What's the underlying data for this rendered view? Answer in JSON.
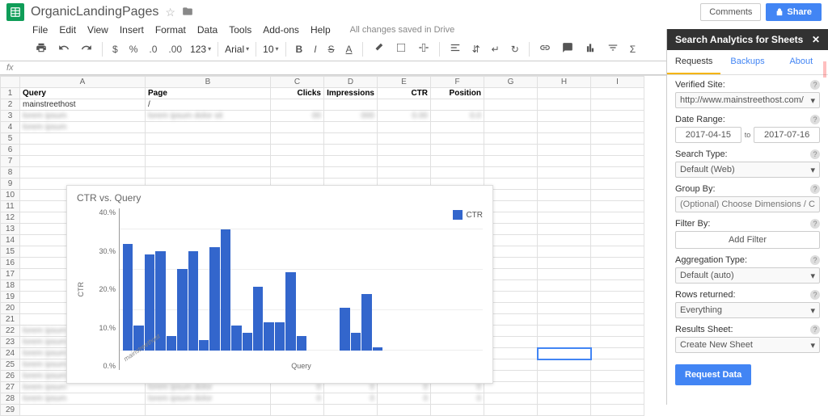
{
  "doc": {
    "title": "OrganicLandingPages",
    "comments_label": "Comments",
    "share_label": "Share",
    "save_status": "All changes saved in Drive"
  },
  "menus": [
    "File",
    "Edit",
    "View",
    "Insert",
    "Format",
    "Data",
    "Tools",
    "Add-ons",
    "Help"
  ],
  "toolbar": {
    "currency": "$",
    "percent": "%",
    "dec_dec": ".0",
    "dec_inc": ".00",
    "numfmt": "123",
    "font": "Arial",
    "size": "10"
  },
  "fx_label": "fx",
  "columns": [
    "A",
    "B",
    "C",
    "D",
    "E",
    "F",
    "G",
    "H",
    "I"
  ],
  "headers": {
    "A": "Query",
    "B": "Page",
    "C": "Clicks",
    "D": "Impressions",
    "E": "CTR",
    "F": "Position"
  },
  "row2": {
    "A": "mainstreethost",
    "B": "/"
  },
  "chart_data": {
    "type": "bar",
    "title": "CTR vs. Query",
    "xlabel": "Query",
    "ylabel": "CTR",
    "ylim": [
      0,
      40
    ],
    "yticks": [
      "40.%",
      "30.%",
      "20.%",
      "10.%",
      "0.%"
    ],
    "categories_shown": "mainstreethost",
    "series": [
      {
        "name": "CTR",
        "values": [
          30,
          7,
          27,
          28,
          4,
          23,
          28,
          3,
          29,
          34,
          7,
          5,
          18,
          8,
          8,
          22,
          4,
          0,
          0,
          0,
          12,
          5,
          16,
          1
        ]
      }
    ]
  },
  "sidebar": {
    "title": "Search Analytics for Sheets",
    "tabs": [
      "Requests",
      "Backups",
      "About"
    ],
    "verified_label": "Verified Site:",
    "verified_value": "http://www.mainstreethost.com/",
    "daterange_label": "Date Range:",
    "date_from": "2017-04-15",
    "date_to_label": "to",
    "date_to": "2017-07-16",
    "searchtype_label": "Search Type:",
    "searchtype_value": "Default (Web)",
    "groupby_label": "Group By:",
    "groupby_placeholder": "(Optional) Choose Dimensions / Columns",
    "filterby_label": "Filter By:",
    "addfilter_label": "Add Filter",
    "aggregation_label": "Aggregation Type:",
    "aggregation_value": "Default (auto)",
    "rows_label": "Rows returned:",
    "rows_value": "Everything",
    "results_label": "Results Sheet:",
    "results_value": "Create New Sheet",
    "request_label": "Request Data"
  }
}
